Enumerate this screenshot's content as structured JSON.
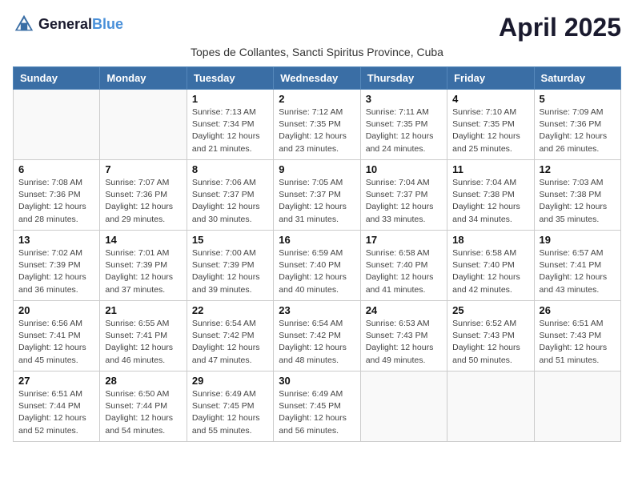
{
  "header": {
    "logo_general": "General",
    "logo_blue": "Blue",
    "title": "April 2025",
    "subtitle": "Topes de Collantes, Sancti Spiritus Province, Cuba"
  },
  "days_of_week": [
    "Sunday",
    "Monday",
    "Tuesday",
    "Wednesday",
    "Thursday",
    "Friday",
    "Saturday"
  ],
  "weeks": [
    [
      {
        "day": "",
        "detail": ""
      },
      {
        "day": "",
        "detail": ""
      },
      {
        "day": "1",
        "detail": "Sunrise: 7:13 AM\nSunset: 7:34 PM\nDaylight: 12 hours and 21 minutes."
      },
      {
        "day": "2",
        "detail": "Sunrise: 7:12 AM\nSunset: 7:35 PM\nDaylight: 12 hours and 23 minutes."
      },
      {
        "day": "3",
        "detail": "Sunrise: 7:11 AM\nSunset: 7:35 PM\nDaylight: 12 hours and 24 minutes."
      },
      {
        "day": "4",
        "detail": "Sunrise: 7:10 AM\nSunset: 7:35 PM\nDaylight: 12 hours and 25 minutes."
      },
      {
        "day": "5",
        "detail": "Sunrise: 7:09 AM\nSunset: 7:36 PM\nDaylight: 12 hours and 26 minutes."
      }
    ],
    [
      {
        "day": "6",
        "detail": "Sunrise: 7:08 AM\nSunset: 7:36 PM\nDaylight: 12 hours and 28 minutes."
      },
      {
        "day": "7",
        "detail": "Sunrise: 7:07 AM\nSunset: 7:36 PM\nDaylight: 12 hours and 29 minutes."
      },
      {
        "day": "8",
        "detail": "Sunrise: 7:06 AM\nSunset: 7:37 PM\nDaylight: 12 hours and 30 minutes."
      },
      {
        "day": "9",
        "detail": "Sunrise: 7:05 AM\nSunset: 7:37 PM\nDaylight: 12 hours and 31 minutes."
      },
      {
        "day": "10",
        "detail": "Sunrise: 7:04 AM\nSunset: 7:37 PM\nDaylight: 12 hours and 33 minutes."
      },
      {
        "day": "11",
        "detail": "Sunrise: 7:04 AM\nSunset: 7:38 PM\nDaylight: 12 hours and 34 minutes."
      },
      {
        "day": "12",
        "detail": "Sunrise: 7:03 AM\nSunset: 7:38 PM\nDaylight: 12 hours and 35 minutes."
      }
    ],
    [
      {
        "day": "13",
        "detail": "Sunrise: 7:02 AM\nSunset: 7:39 PM\nDaylight: 12 hours and 36 minutes."
      },
      {
        "day": "14",
        "detail": "Sunrise: 7:01 AM\nSunset: 7:39 PM\nDaylight: 12 hours and 37 minutes."
      },
      {
        "day": "15",
        "detail": "Sunrise: 7:00 AM\nSunset: 7:39 PM\nDaylight: 12 hours and 39 minutes."
      },
      {
        "day": "16",
        "detail": "Sunrise: 6:59 AM\nSunset: 7:40 PM\nDaylight: 12 hours and 40 minutes."
      },
      {
        "day": "17",
        "detail": "Sunrise: 6:58 AM\nSunset: 7:40 PM\nDaylight: 12 hours and 41 minutes."
      },
      {
        "day": "18",
        "detail": "Sunrise: 6:58 AM\nSunset: 7:40 PM\nDaylight: 12 hours and 42 minutes."
      },
      {
        "day": "19",
        "detail": "Sunrise: 6:57 AM\nSunset: 7:41 PM\nDaylight: 12 hours and 43 minutes."
      }
    ],
    [
      {
        "day": "20",
        "detail": "Sunrise: 6:56 AM\nSunset: 7:41 PM\nDaylight: 12 hours and 45 minutes."
      },
      {
        "day": "21",
        "detail": "Sunrise: 6:55 AM\nSunset: 7:41 PM\nDaylight: 12 hours and 46 minutes."
      },
      {
        "day": "22",
        "detail": "Sunrise: 6:54 AM\nSunset: 7:42 PM\nDaylight: 12 hours and 47 minutes."
      },
      {
        "day": "23",
        "detail": "Sunrise: 6:54 AM\nSunset: 7:42 PM\nDaylight: 12 hours and 48 minutes."
      },
      {
        "day": "24",
        "detail": "Sunrise: 6:53 AM\nSunset: 7:43 PM\nDaylight: 12 hours and 49 minutes."
      },
      {
        "day": "25",
        "detail": "Sunrise: 6:52 AM\nSunset: 7:43 PM\nDaylight: 12 hours and 50 minutes."
      },
      {
        "day": "26",
        "detail": "Sunrise: 6:51 AM\nSunset: 7:43 PM\nDaylight: 12 hours and 51 minutes."
      }
    ],
    [
      {
        "day": "27",
        "detail": "Sunrise: 6:51 AM\nSunset: 7:44 PM\nDaylight: 12 hours and 52 minutes."
      },
      {
        "day": "28",
        "detail": "Sunrise: 6:50 AM\nSunset: 7:44 PM\nDaylight: 12 hours and 54 minutes."
      },
      {
        "day": "29",
        "detail": "Sunrise: 6:49 AM\nSunset: 7:45 PM\nDaylight: 12 hours and 55 minutes."
      },
      {
        "day": "30",
        "detail": "Sunrise: 6:49 AM\nSunset: 7:45 PM\nDaylight: 12 hours and 56 minutes."
      },
      {
        "day": "",
        "detail": ""
      },
      {
        "day": "",
        "detail": ""
      },
      {
        "day": "",
        "detail": ""
      }
    ]
  ]
}
